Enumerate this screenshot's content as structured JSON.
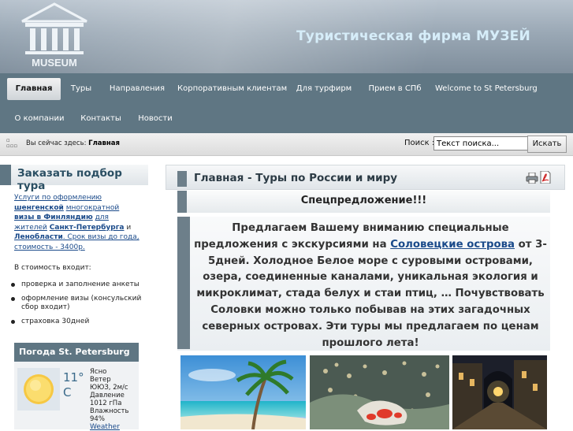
{
  "header": {
    "logo_text": "MUSEUM",
    "site_title": "Туристическая фирма МУЗЕЙ"
  },
  "nav": {
    "row1": [
      "Главная",
      "Туры",
      "Направления",
      "Корпоративным клиентам",
      "Для турфирм",
      "Прием в СПб",
      "Welcome to St Petersburg"
    ],
    "row2": [
      "О компании",
      "Контакты",
      "Новости"
    ],
    "active": "Главная"
  },
  "breadcrumb": {
    "prefix": "Вы сейчас здесь:",
    "current": "Главная"
  },
  "search": {
    "label": "Поиск :",
    "value": "Текст поиска...",
    "button": "Искать"
  },
  "sidebar": {
    "title": "Заказать подбор тура",
    "intro_parts": [
      "Услуги по оформлению",
      "шенгенской",
      "многократной",
      "визы в Финляндию",
      "для жителей",
      "Санкт-Петербурга",
      "и",
      "Ленобласти",
      ". Срок визы до года, стоимость - 3400р."
    ],
    "includes_label": "В стоимость входит:",
    "includes": [
      "проверка и заполнение анкеты",
      "оформление визы (консульский сбор входит)",
      "страховка 30дней"
    ]
  },
  "weather": {
    "title": "Погода St. Petersburg",
    "temp": "11°",
    "unit": "C",
    "condition": "Ясно",
    "wind_label": "Ветер",
    "wind": "ЮЮЗ, 2м/с",
    "pressure_label": "Давление",
    "pressure": "1012 гПа",
    "humidity_label": "Влажность",
    "humidity": "94%",
    "link": "Weather"
  },
  "main": {
    "title": "Главная - Туры по России и миру",
    "special_heading": "Спецпредложение!!!",
    "offer_before": "Предлагаем Вашему вниманию специальные предложения с экскурсиями на",
    "offer_link": "Соловецкие острова",
    "offer_after": "от 3-5дней. Холодное Белое море с суровыми островами, озера, соединенные каналами, уникальная экология и микроклимат, стада белух и стаи птиц, … Почувствовать Соловки можно только побывав на этих загадочных северных островах. Эти туры мы предлагаем по ценам прошлого лета!"
  },
  "colors": {
    "nav_bg": "#5f7683",
    "title_color": "#d6edf9",
    "link": "#1a4a8a",
    "accent_bar": "#6d7f8a"
  }
}
